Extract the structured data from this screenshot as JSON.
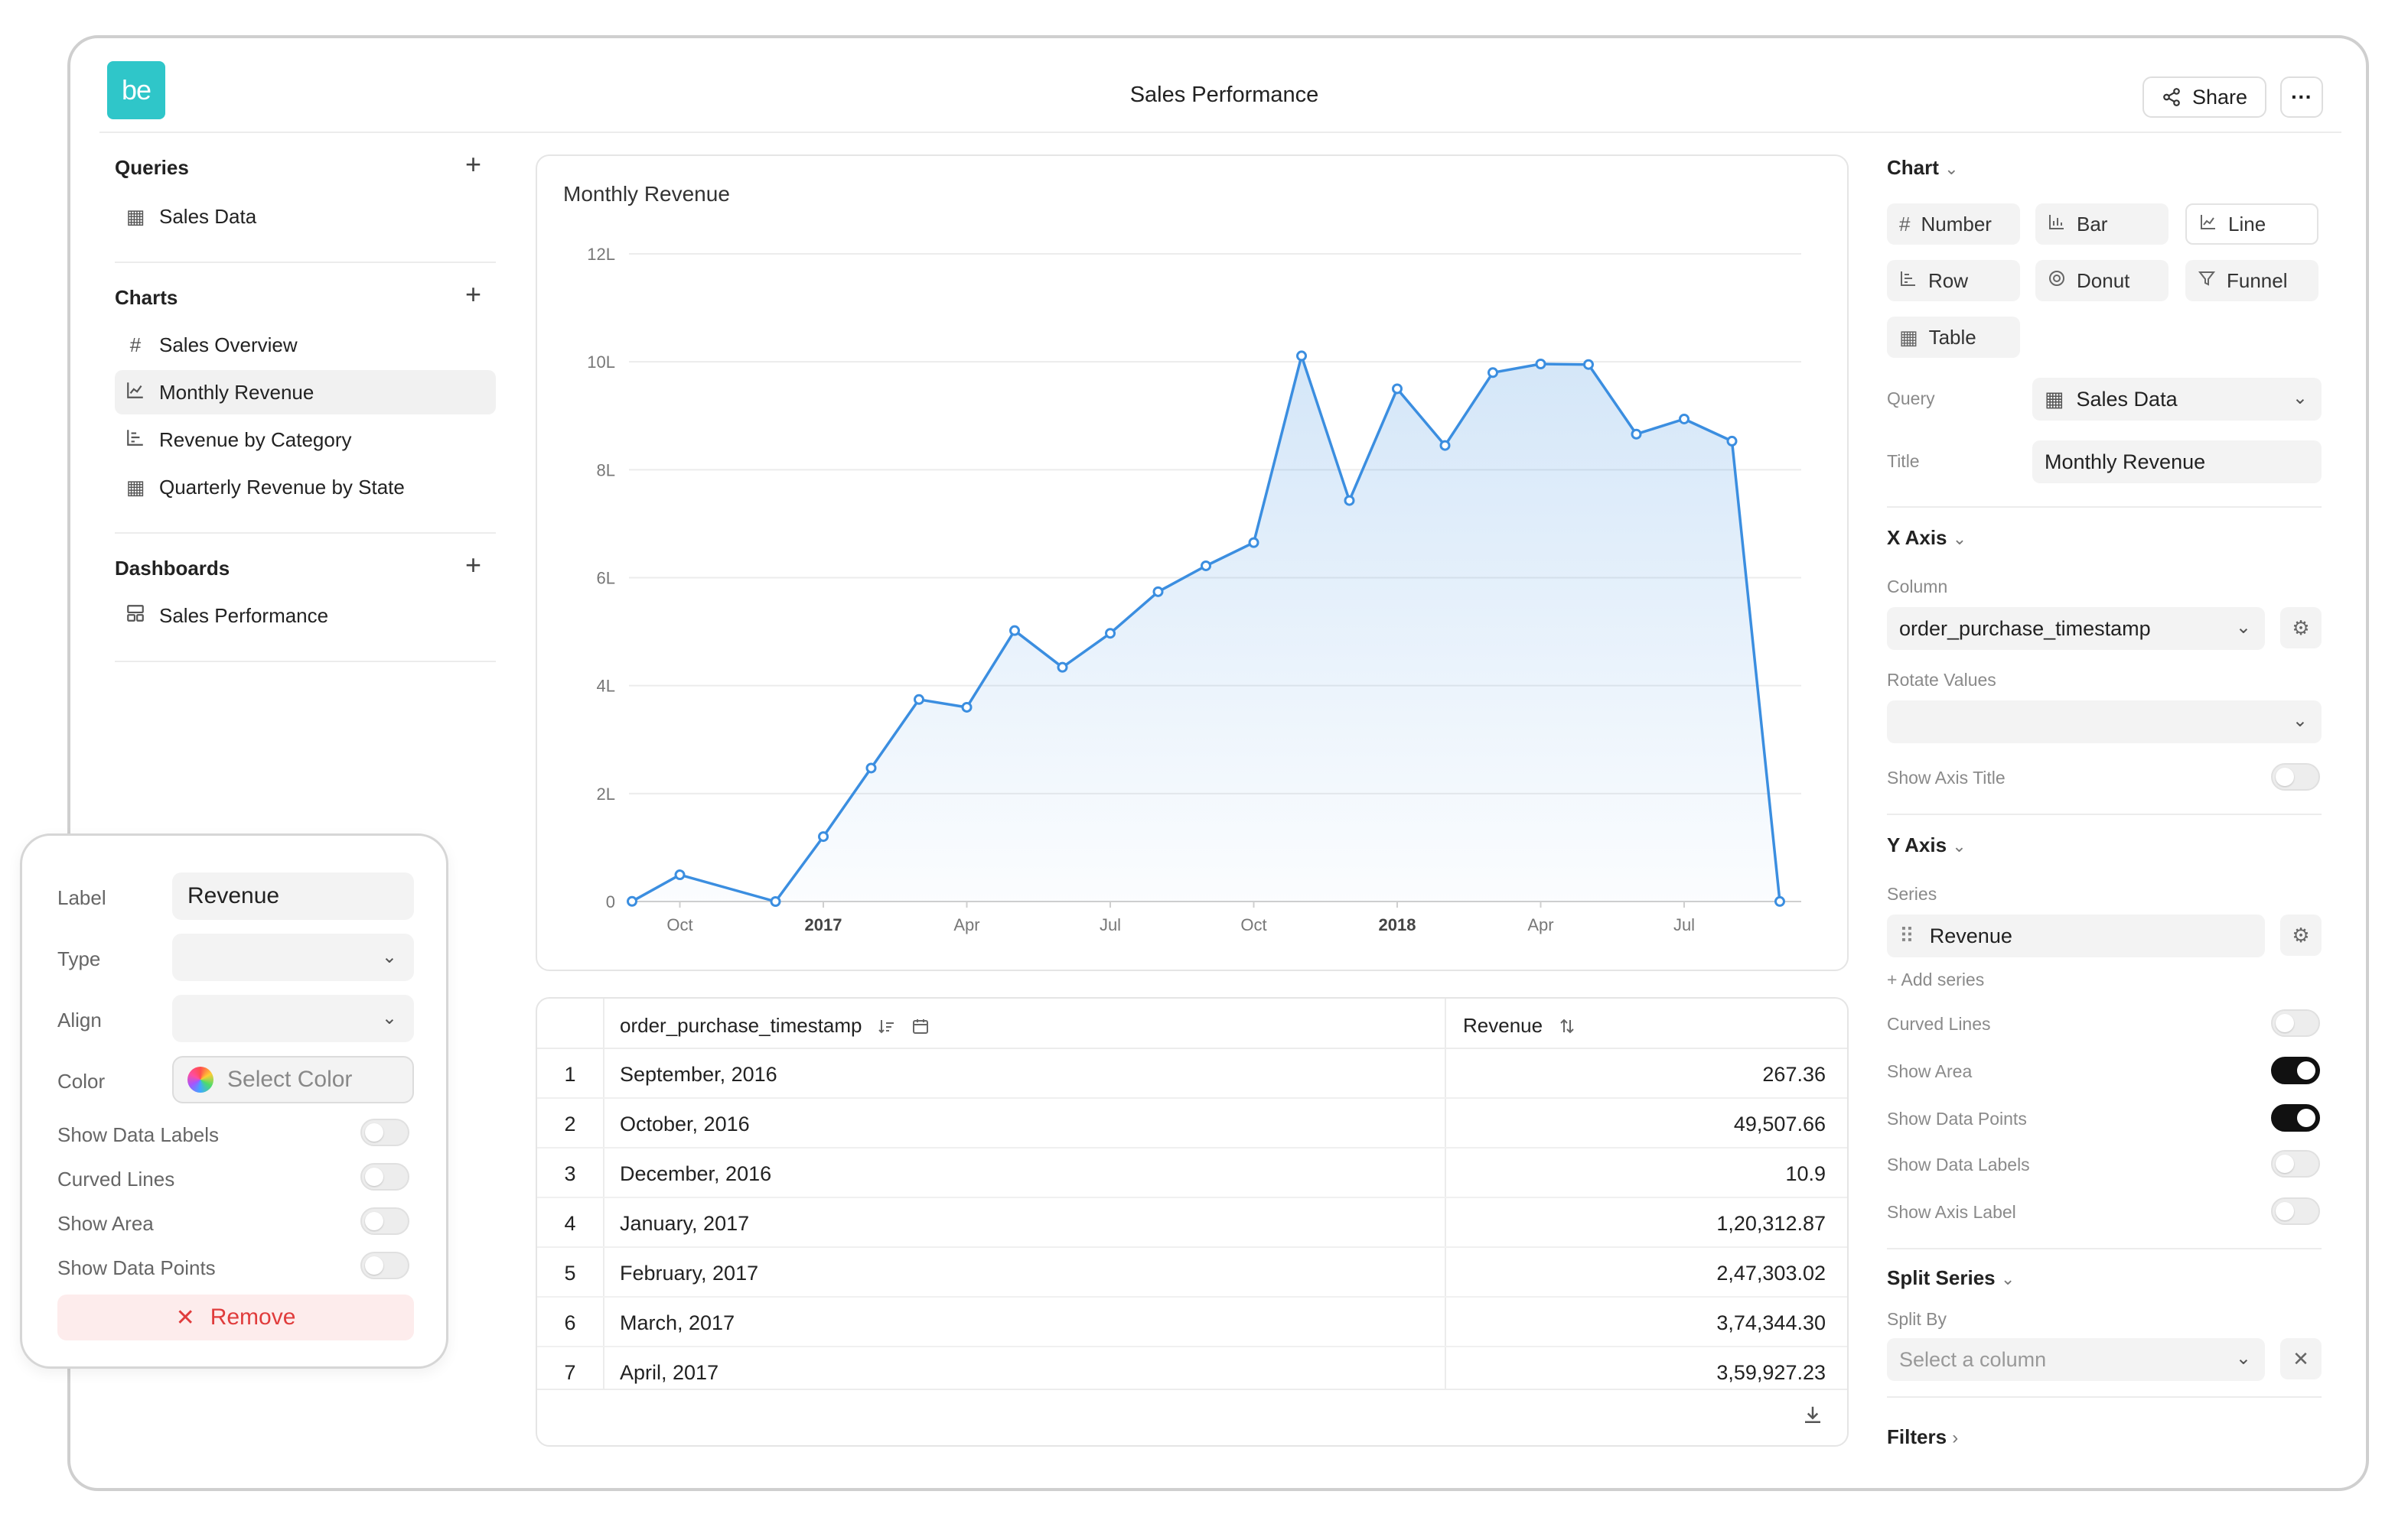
{
  "header": {
    "logo_text": "be",
    "title": "Sales Performance",
    "share_label": "Share",
    "more_label": "···"
  },
  "sidebar": {
    "queries_title": "Queries",
    "queries": [
      {
        "label": "Sales Data",
        "icon": "table-icon"
      }
    ],
    "charts_title": "Charts",
    "charts": [
      {
        "label": "Sales Overview",
        "icon": "hash-icon"
      },
      {
        "label": "Monthly Revenue",
        "icon": "line-chart-icon",
        "active": true
      },
      {
        "label": "Revenue by Category",
        "icon": "row-chart-icon"
      },
      {
        "label": "Quarterly Revenue by State",
        "icon": "table-icon"
      }
    ],
    "dashboards_title": "Dashboards",
    "dashboards": [
      {
        "label": "Sales Performance",
        "icon": "dashboard-icon"
      }
    ]
  },
  "chart_data": {
    "type": "area",
    "title": "Monthly Revenue",
    "y_tick_labels": [
      "0",
      "2L",
      "4L",
      "6L",
      "8L",
      "10L",
      "12L"
    ],
    "ylim": [
      0,
      1200000
    ],
    "x_tick_labels": [
      "Oct",
      "2017",
      "Apr",
      "Jul",
      "Oct",
      "2018",
      "Apr",
      "Jul"
    ],
    "x": [
      "2016-09",
      "2016-10",
      "2016-12",
      "2017-01",
      "2017-02",
      "2017-03",
      "2017-04",
      "2017-05",
      "2017-06",
      "2017-07",
      "2017-08",
      "2017-09",
      "2017-10",
      "2017-11",
      "2017-12",
      "2018-01",
      "2018-02",
      "2018-03",
      "2018-04",
      "2018-05",
      "2018-06",
      "2018-07",
      "2018-08",
      "2018-09"
    ],
    "series": [
      {
        "values": [
          267.36,
          49507.66,
          10.9,
          120312.87,
          247303.02,
          374344.3,
          359927.23,
          502000,
          434000,
          497000,
          574000,
          622000,
          665000,
          1011000,
          743000,
          950000,
          845000,
          980000,
          996000,
          995000,
          866000,
          894000,
          853000,
          145
        ],
        "color": "#3b8ee0"
      }
    ],
    "grid": true,
    "show_area": true,
    "show_points": true
  },
  "table": {
    "col_timestamp": "order_purchase_timestamp",
    "col_revenue": "Revenue",
    "rows": [
      {
        "n": "1",
        "date": "September, 2016",
        "value": "267.36"
      },
      {
        "n": "2",
        "date": "October, 2016",
        "value": "49,507.66"
      },
      {
        "n": "3",
        "date": "December, 2016",
        "value": "10.9"
      },
      {
        "n": "4",
        "date": "January, 2017",
        "value": "1,20,312.87"
      },
      {
        "n": "5",
        "date": "February, 2017",
        "value": "2,47,303.02"
      },
      {
        "n": "6",
        "date": "March, 2017",
        "value": "3,74,344.30"
      },
      {
        "n": "7",
        "date": "April, 2017",
        "value": "3,59,927.23"
      }
    ]
  },
  "panel": {
    "chart_title": "Chart",
    "types": [
      {
        "label": "Number",
        "icon": "hash-icon"
      },
      {
        "label": "Bar",
        "icon": "bar-chart-icon"
      },
      {
        "label": "Line",
        "icon": "line-chart-icon",
        "selected": true
      },
      {
        "label": "Row",
        "icon": "row-chart-icon"
      },
      {
        "label": "Donut",
        "icon": "donut-icon"
      },
      {
        "label": "Funnel",
        "icon": "funnel-icon"
      },
      {
        "label": "Table",
        "icon": "table-icon"
      }
    ],
    "query_label": "Query",
    "query_value": "Sales Data",
    "title_label": "Title",
    "title_value": "Monthly Revenue",
    "x_axis_title": "X Axis",
    "column_label": "Column",
    "column_value": "order_purchase_timestamp",
    "rotate_label": "Rotate Values",
    "show_axis_title_label": "Show Axis Title",
    "y_axis_title": "Y Axis",
    "series_label": "Series",
    "series_value": "Revenue",
    "add_series": "+ Add series",
    "y_toggles": [
      {
        "label": "Curved Lines",
        "on": false
      },
      {
        "label": "Show Area",
        "on": true
      },
      {
        "label": "Show Data Points",
        "on": true
      },
      {
        "label": "Show Data Labels",
        "on": false
      },
      {
        "label": "Show Axis Label",
        "on": false
      }
    ],
    "split_title": "Split Series",
    "split_by_label": "Split By",
    "split_placeholder": "Select a column",
    "filters_title": "Filters"
  },
  "popup": {
    "label_label": "Label",
    "label_value": "Revenue",
    "type_label": "Type",
    "align_label": "Align",
    "color_label": "Color",
    "color_placeholder": "Select Color",
    "toggles": [
      {
        "label": "Show Data Labels",
        "on": false
      },
      {
        "label": "Curved Lines",
        "on": false
      },
      {
        "label": "Show Area",
        "on": false
      },
      {
        "label": "Show Data Points",
        "on": false
      }
    ],
    "remove_label": "Remove"
  }
}
